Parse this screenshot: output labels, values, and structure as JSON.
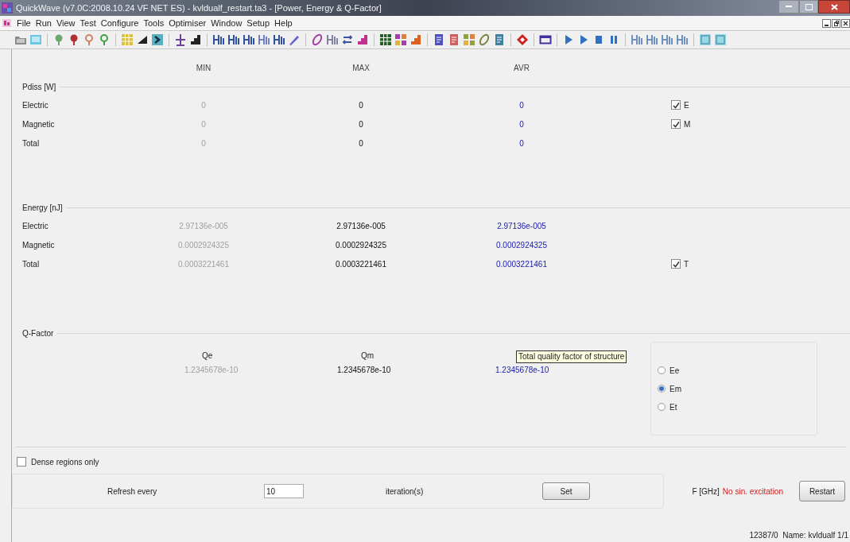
{
  "window": {
    "title": "QuickWave (v7.0C:2008.10.24 VF NET ES) - kvldualf_restart.ta3 - [Power, Energy & Q-Factor]"
  },
  "menu": [
    "File",
    "Run",
    "View",
    "Test",
    "Configure",
    "Tools",
    "Optimiser",
    "Window",
    "Setup",
    "Help"
  ],
  "columns": [
    "MIN",
    "MAX",
    "AVR"
  ],
  "sections": [
    {
      "title": "Pdiss [W]",
      "rows": [
        {
          "label": "Electric",
          "min": "0",
          "max": "0",
          "avr": "0",
          "checkbox": {
            "label": "E",
            "checked": true
          }
        },
        {
          "label": "Magnetic",
          "min": "0",
          "max": "0",
          "avr": "0",
          "checkbox": {
            "label": "M",
            "checked": true
          }
        },
        {
          "label": "Total",
          "min": "0",
          "max": "0",
          "avr": "0"
        }
      ]
    },
    {
      "title": "Energy [nJ]",
      "rows": [
        {
          "label": "Electric",
          "min": "2.97136e-005",
          "max": "2.97136e-005",
          "avr": "2.97136e-005"
        },
        {
          "label": "Magnetic",
          "min": "0.0002924325",
          "max": "0.0002924325",
          "avr": "0.0002924325"
        },
        {
          "label": "Total",
          "min": "0.0003221461",
          "max": "0.0003221461",
          "avr": "0.0003221461",
          "checkbox": {
            "label": "T",
            "checked": true
          }
        }
      ]
    }
  ],
  "q_factor": {
    "title": "Q-Factor",
    "columns": [
      {
        "header": "Qe",
        "value": "1.2345678e-10"
      },
      {
        "header": "Qm",
        "value": "1.2345678e-10"
      },
      {
        "tooltip": "Total quality factor of structure",
        "value": "1.2345678e-10"
      }
    ],
    "radios": [
      {
        "label": "Ee",
        "selected": false
      },
      {
        "label": "Em",
        "selected": true
      },
      {
        "label": "Et",
        "selected": false
      }
    ]
  },
  "dense_regions": {
    "label": "Dense regions only",
    "checked": false
  },
  "refresh": {
    "label": "Refresh every",
    "value": "10",
    "unit": "iteration(s)",
    "button": "Set"
  },
  "frequency": {
    "label": "F [GHz]",
    "value": "No sin. excitation"
  },
  "restart_button": "Restart",
  "status_bar": "12387/0  Name: kvldualf 1/1"
}
